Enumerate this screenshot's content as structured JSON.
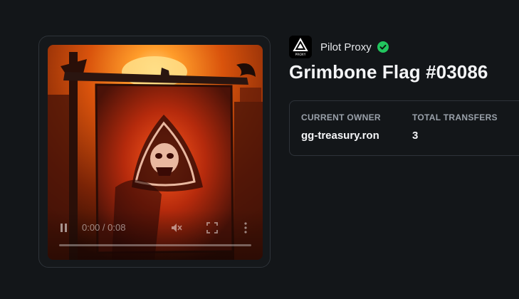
{
  "collection": {
    "name": "Pilot Proxy",
    "logo_text": "PROXY",
    "verified_icon": "verified-check-icon",
    "verified_color": "#22c55e"
  },
  "nft": {
    "title": "Grimbone Flag #03086"
  },
  "details": {
    "owner_label": "CURRENT OWNER",
    "owner_value": "gg-treasury.ron",
    "transfers_label": "TOTAL TRANSFERS",
    "transfers_value": "3"
  },
  "video": {
    "time": "0:00 / 0:08",
    "progress": 0,
    "controls": [
      "pause-icon",
      "mute-icon",
      "fullscreen-icon",
      "more-options-icon"
    ]
  },
  "colors": {
    "background": "#131619",
    "border": "#2e3339",
    "accent_green": "#22c55e"
  }
}
